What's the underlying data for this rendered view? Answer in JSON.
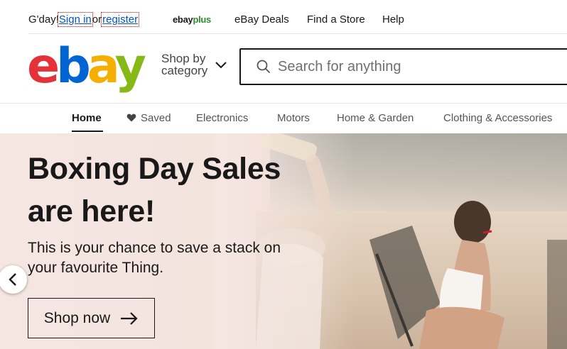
{
  "topbar": {
    "greeting": "G'day!",
    "sign_in": "Sign in",
    "or": "or",
    "register": "register",
    "ebayplus_brand": "ebay",
    "ebayplus_suffix": "plus",
    "deals": "eBay Deals",
    "find_store": "Find a Store",
    "help": "Help"
  },
  "header": {
    "logo": {
      "e": "e",
      "b": "b",
      "a": "a",
      "y": "y"
    },
    "shop_by_line1": "Shop by",
    "shop_by_line2": "category",
    "search_placeholder": "Search for anything"
  },
  "nav": {
    "tabs": [
      {
        "label": "Home",
        "active": true
      },
      {
        "label": "Saved",
        "icon": "heart-icon"
      },
      {
        "label": "Electronics"
      },
      {
        "label": "Motors"
      },
      {
        "label": "Home & Garden"
      },
      {
        "label": "Clothing & Accessories"
      }
    ]
  },
  "hero": {
    "title_line1": "Boxing Day Sales",
    "title_line2": "are here!",
    "description_line1": "This is your chance to save a stack on",
    "description_line2": "your favourite Thing.",
    "cta": "Shop now"
  },
  "colors": {
    "link": "#0654ba",
    "logo_e": "#e53238",
    "logo_b": "#0064d2",
    "logo_a": "#f5af02",
    "logo_y": "#86b817",
    "hero_bg": "#f5e6e2"
  }
}
